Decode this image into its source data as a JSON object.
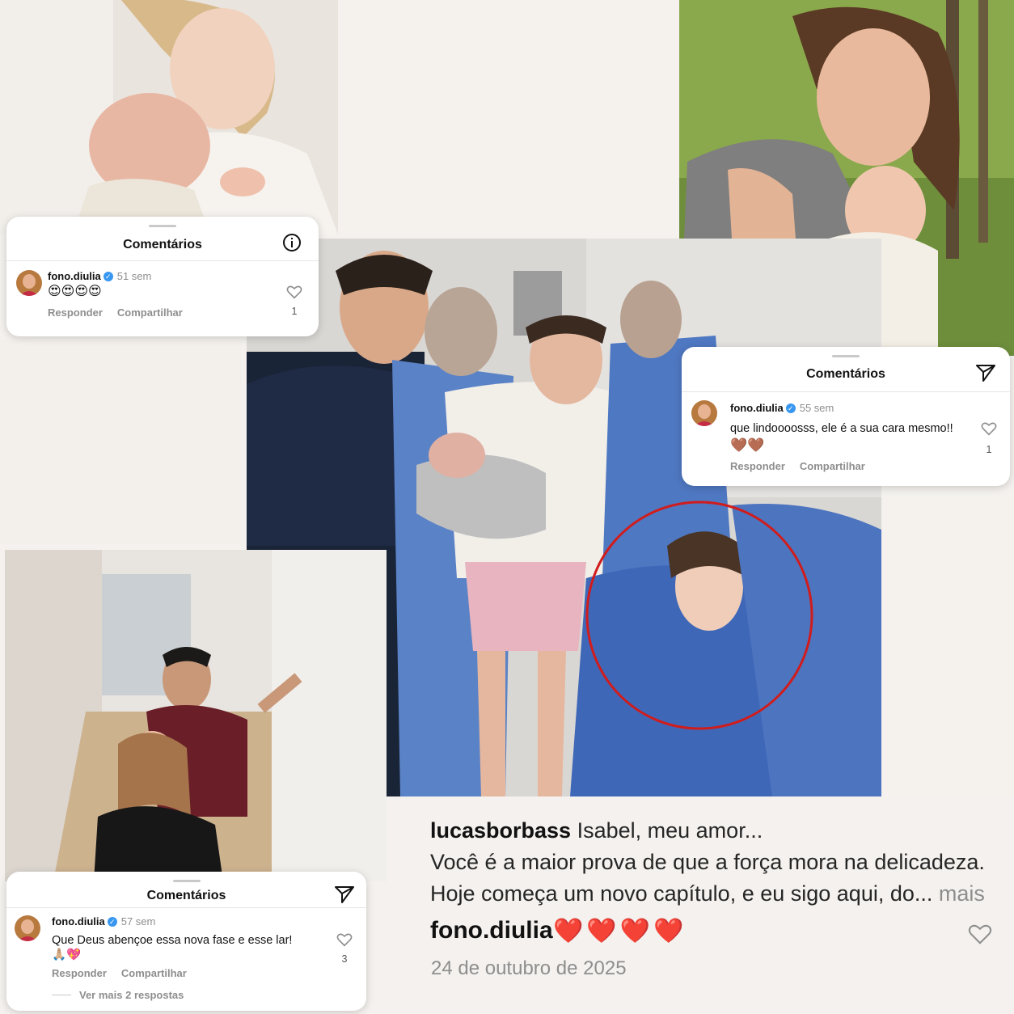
{
  "colors": {
    "accent_red": "#d01c1c",
    "muted": "#8e8e8e",
    "verified": "#3897f0",
    "scrubs": "#3d68b8"
  },
  "card1": {
    "title": "Comentários",
    "header_icon": "info-icon",
    "user": "fono.diulia",
    "weeks": "51 sem",
    "text": "😍😍😍😍",
    "reply": "Responder",
    "share": "Compartilhar",
    "likes": "1"
  },
  "card2": {
    "title": "Comentários",
    "header_icon": "send-icon",
    "user": "fono.diulia",
    "weeks": "55 sem",
    "text": "que lindoooosss, ele é a sua cara mesmo!!",
    "text2": "🤎🤎",
    "reply": "Responder",
    "share": "Compartilhar",
    "likes": "1"
  },
  "card3": {
    "title": "Comentários",
    "header_icon": "send-icon",
    "user": "fono.diulia",
    "weeks": "57 sem",
    "text": "Que Deus abençoe essa nova fase e esse lar! 🙏🏼💖",
    "reply": "Responder",
    "share": "Compartilhar",
    "likes": "3",
    "more_replies": "Ver mais 2 respostas"
  },
  "post": {
    "author": "lucasborbass",
    "caption_line1": "Isabel, meu amor...",
    "caption_line2": "Você é a maior prova de que a força mora na delicadeza.",
    "caption_line3": "Hoje começa um novo capítulo, e eu sigo aqui, do...",
    "more": "mais",
    "comment_user": "fono.diulia",
    "comment_hearts": "❤️❤️❤️❤️",
    "date": "24 de outubro de 2025"
  }
}
